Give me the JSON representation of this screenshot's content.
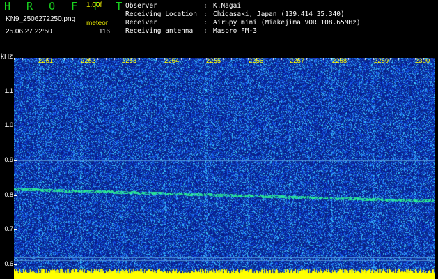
{
  "header": {
    "app_title": "H R O F F T",
    "version": "1.00f",
    "file_name": "KN9_2506272250.png",
    "mode": "meteor",
    "timestamp": "25.06.27 22:50",
    "count": "116"
  },
  "info": [
    {
      "key": "Observer",
      "value": "K.Nagai"
    },
    {
      "key": "Receiving Location",
      "value": "Chigasaki, Japan (139.414 35.340)"
    },
    {
      "key": "Receiver",
      "value": "AirSpy mini (Miakejima VOR 108.65MHz)"
    },
    {
      "key": "Receiving antenna",
      "value": "Maspro FM-3"
    }
  ],
  "spectrogram": {
    "freq_unit": "kHz",
    "y_ticks": [
      "1.1",
      "1.0",
      "0.9",
      "0.8",
      "0.7",
      "0.6"
    ],
    "x_ticks": [
      "2251",
      "2252",
      "2253",
      "2254",
      "2255",
      "2256",
      "2257",
      "2258",
      "2259",
      "2300"
    ],
    "colors": {
      "background": "#0a1a8c",
      "noise": "#3a7bff",
      "signal": "#2fe0a0",
      "baseline": "#ffff00"
    }
  }
}
